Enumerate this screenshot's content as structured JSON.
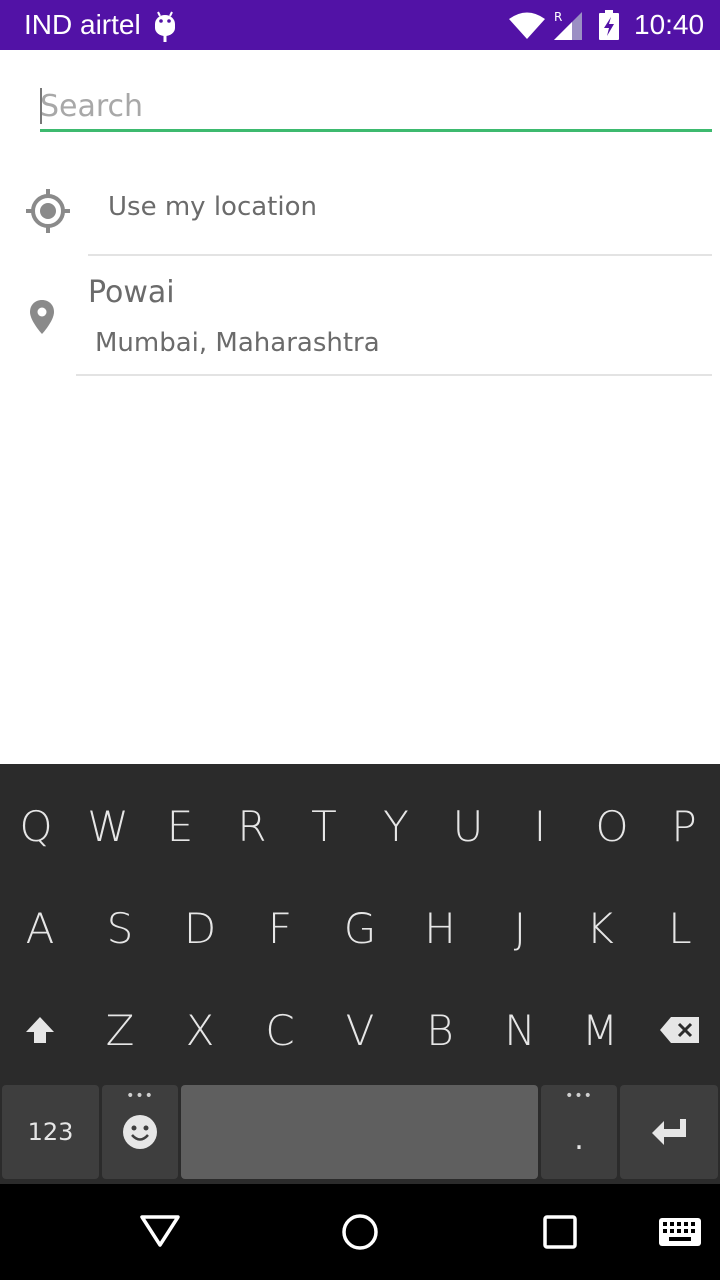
{
  "status_bar": {
    "carrier": "IND airtel",
    "time": "10:40",
    "background": "#5212a6"
  },
  "search": {
    "placeholder": "Search",
    "value": "",
    "underline_color": "#3dba6f"
  },
  "results": {
    "use_location_label": "Use my location",
    "place": {
      "title": "Powai",
      "subtitle": "Mumbai, Maharashtra"
    }
  },
  "keyboard": {
    "row1": [
      "Q",
      "W",
      "E",
      "R",
      "T",
      "Y",
      "U",
      "I",
      "O",
      "P"
    ],
    "row2": [
      "A",
      "S",
      "D",
      "F",
      "G",
      "H",
      "J",
      "K",
      "L"
    ],
    "row3": [
      "Z",
      "X",
      "C",
      "V",
      "B",
      "N",
      "M"
    ],
    "symbols_label": "123",
    "period_label": ".",
    "dots": "•••"
  },
  "icons": {
    "status": [
      "android-icon",
      "wifi-icon",
      "signal-icon",
      "battery-charging-icon"
    ],
    "list": [
      "my-location-icon",
      "location-pin-icon"
    ],
    "keyboard": [
      "shift-icon",
      "backspace-icon",
      "emoji-icon",
      "enter-icon"
    ],
    "nav": [
      "back-icon",
      "home-icon",
      "recents-icon",
      "keyboard-icon"
    ]
  }
}
